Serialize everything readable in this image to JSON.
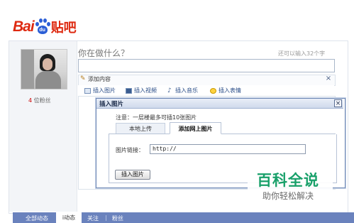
{
  "logo": {
    "bai": "Bai",
    "du": "du",
    "tieba": "贴吧"
  },
  "profile": {
    "fans_count": "4",
    "fans_label": "位粉丝"
  },
  "composer": {
    "question": "你在做什么？",
    "remaining": "还可以输入32个字",
    "input_value": ""
  },
  "add_content": {
    "label": "添加内容",
    "close": "×",
    "toolbar": [
      {
        "label": "插入图片",
        "icon": "image-icon"
      },
      {
        "label": "插入视频",
        "icon": "video-icon"
      },
      {
        "label": "插入音乐",
        "icon": "music-icon"
      },
      {
        "label": "插入表情",
        "icon": "emoticon-icon"
      }
    ]
  },
  "dialog": {
    "title": "插入图片",
    "close": "×",
    "notice": "注意：一层楼最多可插10张图片",
    "tabs": {
      "local": "本地上传",
      "web": "添加网上图片"
    },
    "link_label": "图片链接：",
    "link_value": "http://",
    "insert_button": "插入图片"
  },
  "bottom_nav": {
    "all": "全部动态",
    "mine": "i动态",
    "follow": "关注",
    "separator": "|",
    "fans": "粉丝"
  },
  "watermark": {
    "title": "百科全说",
    "subtitle": "助你轻松解决"
  },
  "colors": {
    "brand_red": "#de2910",
    "brand_blue": "#2c5fd6",
    "nav_bar": "#6a82bd",
    "watermark_green": "#18a06a"
  }
}
